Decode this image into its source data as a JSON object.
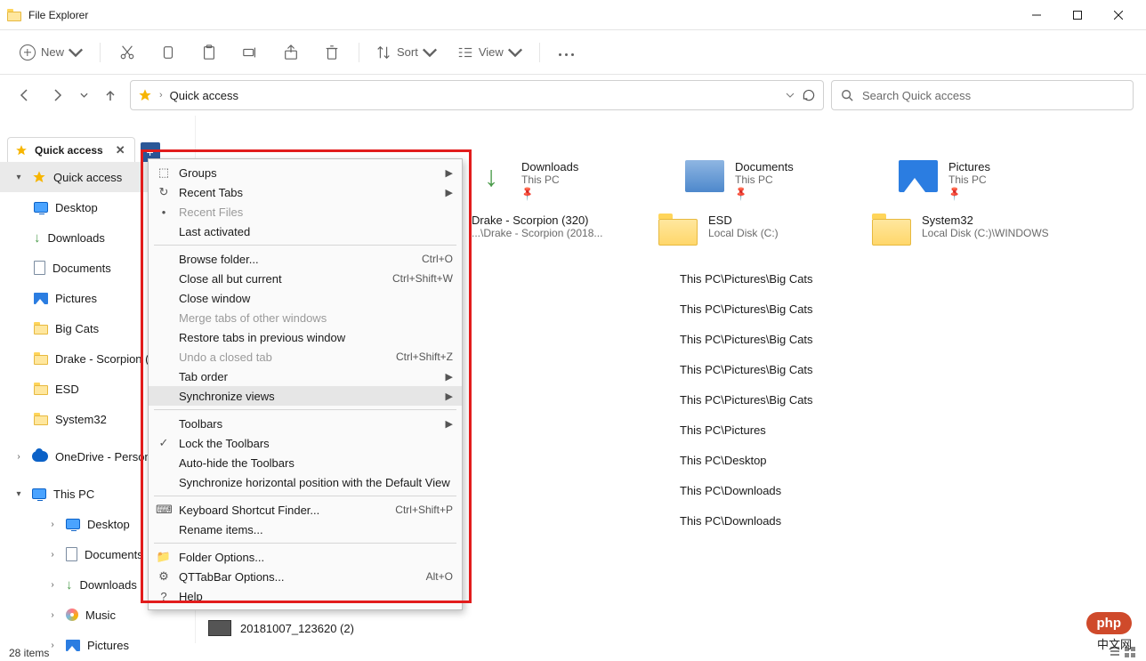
{
  "window": {
    "title": "File Explorer"
  },
  "toolbar": {
    "new": "New",
    "sort": "Sort",
    "view": "View"
  },
  "address": {
    "location": "Quick access",
    "search_placeholder": "Search Quick access"
  },
  "tab": {
    "label": "Quick access"
  },
  "sidebar": {
    "quick_access": "Quick access",
    "items": [
      {
        "label": "Desktop"
      },
      {
        "label": "Downloads"
      },
      {
        "label": "Documents"
      },
      {
        "label": "Pictures"
      },
      {
        "label": "Big Cats"
      },
      {
        "label": "Drake - Scorpion ("
      },
      {
        "label": "ESD"
      },
      {
        "label": "System32"
      }
    ],
    "onedrive": "OneDrive - Persona",
    "this_pc": "This PC",
    "pc_children": [
      {
        "label": "Desktop"
      },
      {
        "label": "Documents"
      },
      {
        "label": "Downloads"
      },
      {
        "label": "Music"
      },
      {
        "label": "Pictures"
      }
    ]
  },
  "tiles_row1": [
    {
      "title": "Downloads",
      "sub": "This PC"
    },
    {
      "title": "Documents",
      "sub": "This PC"
    },
    {
      "title": "Pictures",
      "sub": "This PC"
    }
  ],
  "tiles_row2": [
    {
      "title": "Drake - Scorpion (320)",
      "sub": "...\\Drake - Scorpion (2018..."
    },
    {
      "title": "ESD",
      "sub": "Local Disk (C:)"
    },
    {
      "title": "System32",
      "sub": "Local Disk (C:)\\WINDOWS"
    }
  ],
  "paths": [
    "This PC\\Pictures\\Big Cats",
    "This PC\\Pictures\\Big Cats",
    "This PC\\Pictures\\Big Cats",
    "This PC\\Pictures\\Big Cats",
    "This PC\\Pictures\\Big Cats",
    "This PC\\Pictures",
    "This PC\\Desktop",
    "This PC\\Downloads",
    "This PC\\Downloads"
  ],
  "last_file": "20181007_123620 (2)",
  "status": "28 items",
  "context_menu": [
    {
      "label": "Groups",
      "sub": true,
      "icon": "⬚"
    },
    {
      "label": "Recent Tabs",
      "sub": true,
      "icon": "↻"
    },
    {
      "label": "Recent Files",
      "disabled": true,
      "icon": "•"
    },
    {
      "label": "Last activated"
    },
    {
      "sep": true
    },
    {
      "label": "Browse folder...",
      "shortcut": "Ctrl+O"
    },
    {
      "label": "Close all but current",
      "shortcut": "Ctrl+Shift+W"
    },
    {
      "label": "Close window"
    },
    {
      "label": "Merge tabs of other windows",
      "disabled": true
    },
    {
      "label": "Restore tabs in previous window"
    },
    {
      "label": "Undo a closed tab",
      "shortcut": "Ctrl+Shift+Z",
      "disabled": true
    },
    {
      "label": "Tab order",
      "sub": true
    },
    {
      "label": "Synchronize views",
      "sub": true,
      "hover": true
    },
    {
      "sep": true
    },
    {
      "label": "Toolbars",
      "sub": true
    },
    {
      "label": "Lock the Toolbars",
      "icon": "✓"
    },
    {
      "label": "Auto-hide the Toolbars"
    },
    {
      "label": "Synchronize horizontal position with the Default View"
    },
    {
      "sep": true
    },
    {
      "label": "Keyboard Shortcut Finder...",
      "shortcut": "Ctrl+Shift+P",
      "icon": "⌨"
    },
    {
      "label": "Rename items..."
    },
    {
      "sep": true
    },
    {
      "label": "Folder Options...",
      "icon": "📁"
    },
    {
      "label": "QTTabBar Options...",
      "shortcut": "Alt+O",
      "icon": "⚙"
    },
    {
      "label": "Help",
      "icon": "?"
    }
  ],
  "badge": {
    "php": "php",
    "cn": "中文网"
  }
}
